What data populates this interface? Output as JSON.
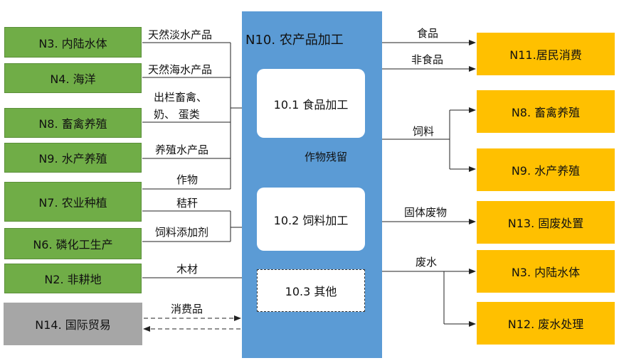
{
  "center": {
    "title": "N10. 农产品加工",
    "sub1": "10.1 食品加工",
    "sub2": "10.2 饲料加工",
    "sub3": "10.3  其他",
    "internal_label": "作物残留"
  },
  "left_nodes": [
    "N3. 内陆水体",
    "N4. 海洋",
    "N8. 畜禽养殖",
    "N9. 水产养殖",
    "N7. 农业种植",
    "N6. 磷化工生产",
    "N2. 非耕地",
    "N14. 国际贸易"
  ],
  "left_flows": {
    "f1": "天然淡水产品",
    "f2": "天然海水产品",
    "f3a": "出栏畜禽、",
    "f3b": "奶、 蛋类",
    "f4": "养殖水产品",
    "f5": "作物",
    "f6": "秸秆",
    "f7": "饲料添加剂",
    "f8": "木材",
    "f9": "消费品"
  },
  "right_nodes": [
    "N11.居民消费",
    "N8. 畜禽养殖",
    "N9. 水产养殖",
    "N13. 固废处置",
    "N3. 内陆水体",
    "N12. 废水处理"
  ],
  "right_flows": {
    "food": "食品",
    "nonfood": "非食品",
    "feed": "饲料",
    "solid": "固体废物",
    "water": "废水"
  },
  "colors": {
    "left": "#70ad47",
    "trade": "#a6a6a6",
    "right": "#ffc000",
    "center": "#5b9bd5"
  }
}
